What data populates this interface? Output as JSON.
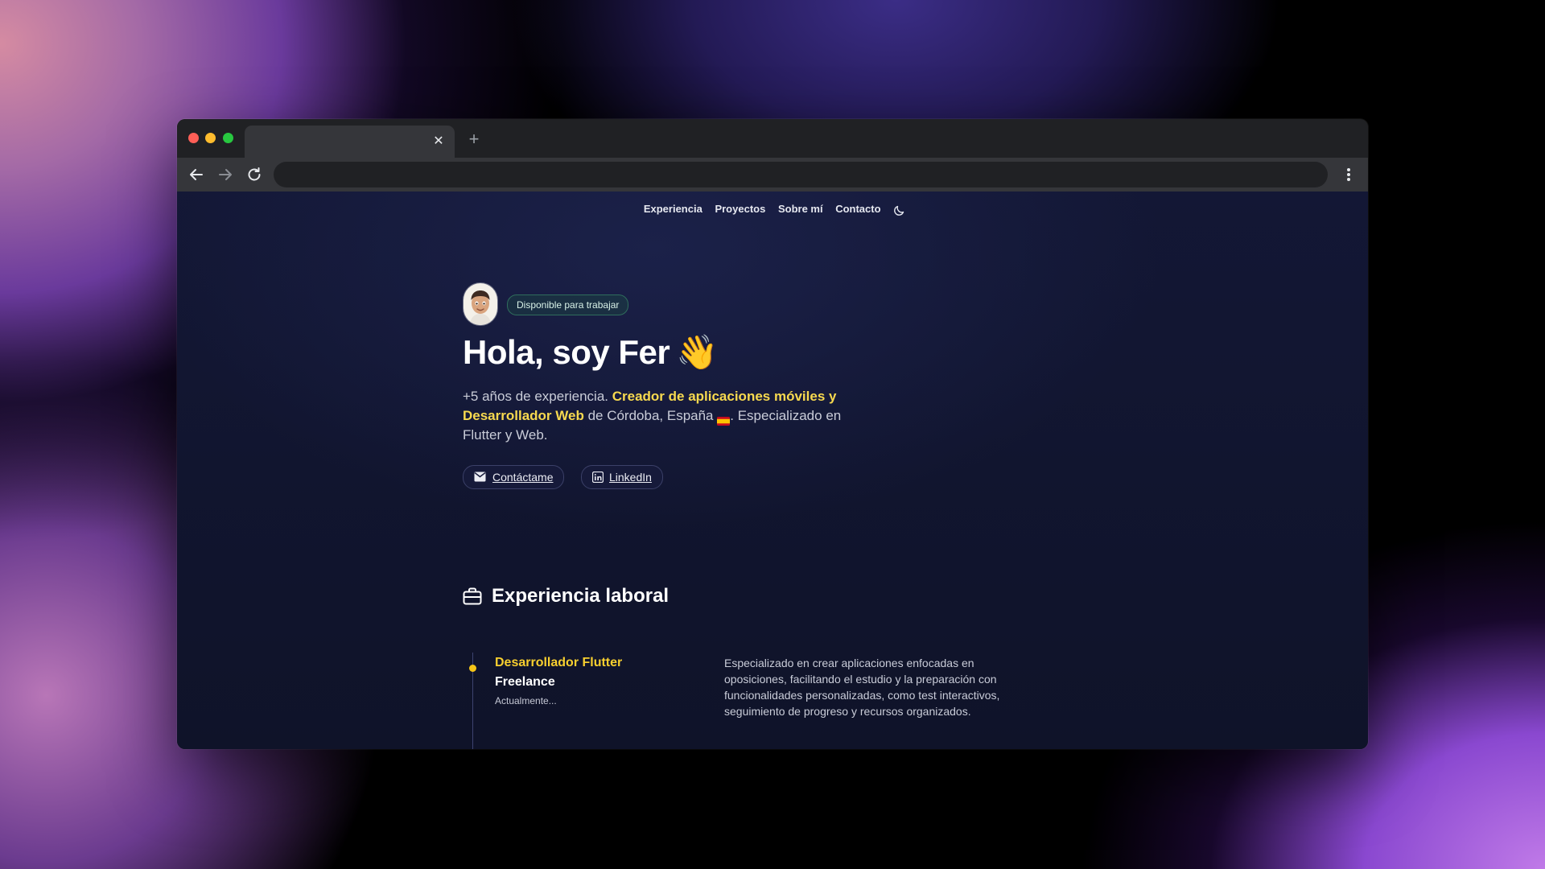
{
  "browser": {
    "tab_close_glyph": "✕",
    "new_tab_glyph": "+"
  },
  "nav": {
    "items": [
      "Experiencia",
      "Proyectos",
      "Sobre mí",
      "Contacto"
    ],
    "theme_toggle_icon": "moon-icon"
  },
  "hero": {
    "badge": "Disponible para trabajar",
    "title": "Hola, soy Fer",
    "title_emoji": "👋",
    "intro_1": "+5 años de experiencia. ",
    "intro_highlight": "Creador de aplicaciones móviles y Desarrollador Web",
    "intro_2": " de Córdoba, España ",
    "intro_3": ". Especializado en Flutter y Web.",
    "buttons": {
      "contact": "Contáctame",
      "linkedin": "LinkedIn"
    }
  },
  "experience": {
    "section_title": "Experiencia laboral",
    "jobs": [
      {
        "title": "Desarrollador Flutter",
        "company": "Freelance",
        "date": "Actualmente...",
        "description": "Especializado en crear aplicaciones enfocadas en oposiciones, facilitando el estudio y la preparación con funcionalidades personalizadas, como test interactivos, seguimiento de progreso y recursos organizados."
      }
    ]
  },
  "colors": {
    "accent_yellow": "#f7d94f",
    "timeline_dot": "#f5c518",
    "badge_border": "#2f6d5c"
  }
}
